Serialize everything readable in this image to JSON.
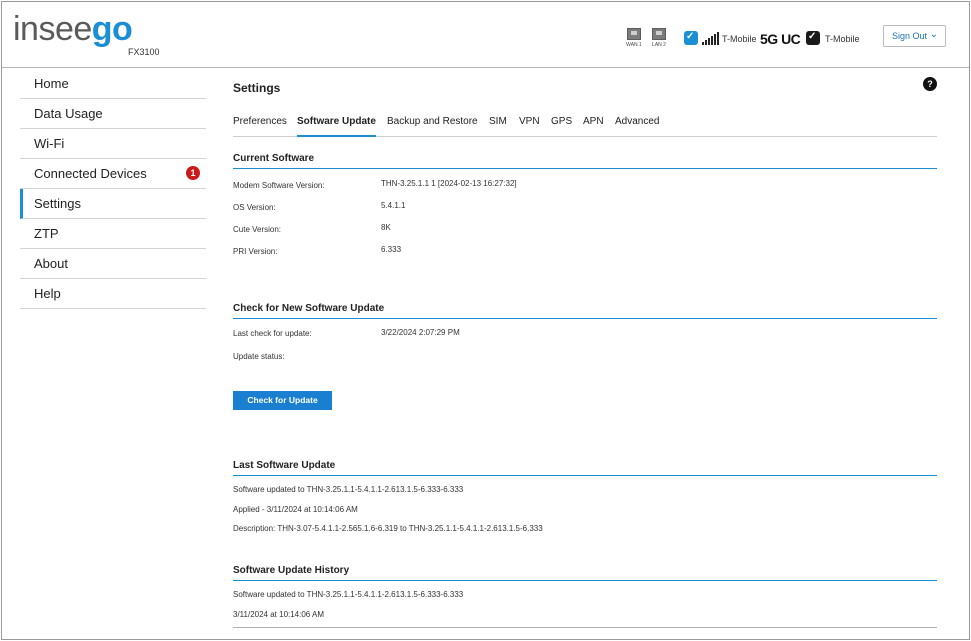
{
  "header": {
    "logo_left": "insee",
    "logo_right": "go",
    "model": "FX3100",
    "ports": [
      "WAN 1",
      "LAN 2"
    ],
    "carrier_1": "T-Mobile",
    "network": "5G UC",
    "carrier_2": "T-Mobile",
    "sign_out_label": "Sign Out"
  },
  "sidebar": {
    "items": [
      {
        "label": "Home"
      },
      {
        "label": "Data Usage"
      },
      {
        "label": "Wi-Fi"
      },
      {
        "label": "Connected Devices",
        "badge": "1"
      },
      {
        "label": "Settings",
        "active": true
      },
      {
        "label": "ZTP"
      },
      {
        "label": "About"
      },
      {
        "label": "Help"
      }
    ]
  },
  "main": {
    "title": "Settings",
    "help_label": "?",
    "tabs": [
      {
        "label": "Preferences"
      },
      {
        "label": "Software Update",
        "active": true
      },
      {
        "label": "Backup and Restore"
      },
      {
        "label": "SIM"
      },
      {
        "label": "VPN"
      },
      {
        "label": "GPS"
      },
      {
        "label": "APN"
      },
      {
        "label": "Advanced"
      }
    ],
    "current_software": {
      "title": "Current Software",
      "rows": [
        {
          "label": "Modem Software Version:",
          "value": "THN-3.25.1.1 1 [2024-02-13 16:27:32]"
        },
        {
          "label": "OS Version:",
          "value": "5.4.1.1"
        },
        {
          "label": "Cute Version:",
          "value": "8K"
        },
        {
          "label": "PRI Version:",
          "value": "6.333"
        }
      ]
    },
    "check_update": {
      "title": "Check for New Software Update",
      "rows": [
        {
          "label": "Last check for update:",
          "value": "3/22/2024 2:07:29 PM"
        },
        {
          "label": "Update status:",
          "value": ""
        }
      ],
      "button_label": "Check for Update"
    },
    "last_update": {
      "title": "Last Software Update",
      "lines": [
        "Software updated to THN-3.25.1.1-5.4.1.1-2.613.1.5-6.333-6.333",
        "Applied - 3/11/2024 at 10:14:06 AM",
        "Description: THN-3.07-5.4.1.1-2.565.1.6-6.319 to THN-3.25.1.1-5.4.1.1-2.613.1.5-6.333"
      ]
    },
    "history": {
      "title": "Software Update History",
      "lines": [
        "Software updated to THN-3.25.1.1-5.4.1.1-2.613.1.5-6.333-6.333",
        "3/11/2024 at 10:14:06 AM"
      ]
    }
  },
  "colors": {
    "accent": "#1a8fd6",
    "button": "#1a7fd0",
    "badge": "#cc1a1a"
  }
}
